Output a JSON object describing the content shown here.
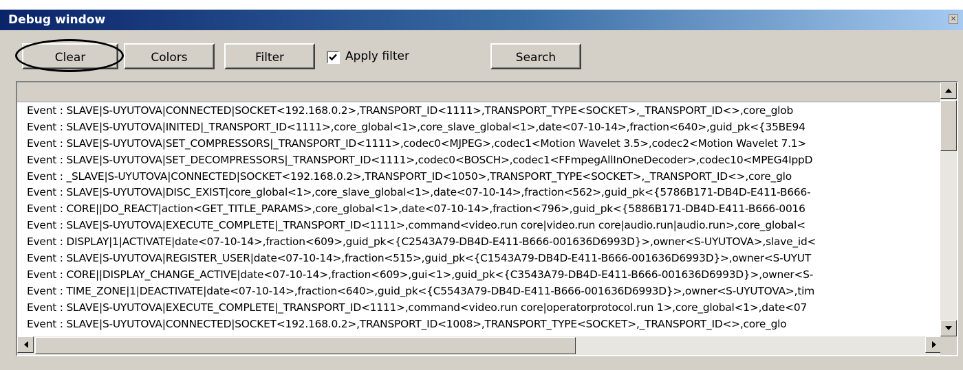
{
  "window": {
    "title": "Debug window",
    "close_glyph": "×"
  },
  "toolbar": {
    "clear_label": "Clear",
    "colors_label": "Colors",
    "filter_label": "Filter",
    "apply_filter_label": "Apply filter",
    "apply_filter_checked": true,
    "search_label": "Search"
  },
  "log": {
    "lines": [
      "Event : SLAVE|S-UYUTOVA|CONNECTED|SOCKET<192.168.0.2>,TRANSPORT_ID<1111>,TRANSPORT_TYPE<SOCKET>,_TRANSPORT_ID<>,core_glob",
      "Event : SLAVE|S-UYUTOVA|INITED|_TRANSPORT_ID<1111>,core_global<1>,core_slave_global<1>,date<07-10-14>,fraction<640>,guid_pk<{35BE94",
      "Event : SLAVE|S-UYUTOVA|SET_COMPRESSORS|_TRANSPORT_ID<1111>,codec0<MJPEG>,codec1<Motion Wavelet 3.5>,codec2<Motion Wavelet 7.1>",
      "Event : SLAVE|S-UYUTOVA|SET_DECOMPRESSORS|_TRANSPORT_ID<1111>,codec0<BOSCH>,codec1<FFmpegAllInOneDecoder>,codec10<MPEG4IppD",
      "Event : _SLAVE|S-UYUTOVA|CONNECTED|SOCKET<192.168.0.2>,TRANSPORT_ID<1050>,TRANSPORT_TYPE<SOCKET>,_TRANSPORT_ID<>,core_glo",
      "Event : SLAVE|S-UYUTOVA|DISC_EXIST|core_global<1>,core_slave_global<1>,date<07-10-14>,fraction<562>,guid_pk<{5786B171-DB4D-E411-B666-",
      "Event : CORE||DO_REACT|action<GET_TITLE_PARAMS>,core_global<1>,date<07-10-14>,fraction<796>,guid_pk<{5886B171-DB4D-E411-B666-0016",
      "Event : SLAVE|S-UYUTOVA|EXECUTE_COMPLETE|_TRANSPORT_ID<1111>,command<video.run core|video.run core|audio.run|audio.run>,core_global<",
      "Event : DISPLAY|1|ACTIVATE|date<07-10-14>,fraction<609>,guid_pk<{C2543A79-DB4D-E411-B666-001636D6993D}>,owner<S-UYUTOVA>,slave_id<",
      "Event : SLAVE|S-UYUTOVA|REGISTER_USER|date<07-10-14>,fraction<515>,guid_pk<{C1543A79-DB4D-E411-B666-001636D6993D}>,owner<S-UYUT",
      "Event : CORE||DISPLAY_CHANGE_ACTIVE|date<07-10-14>,fraction<609>,gui<1>,guid_pk<{C3543A79-DB4D-E411-B666-001636D6993D}>,owner<S-",
      "Event : TIME_ZONE|1|DEACTIVATE|date<07-10-14>,fraction<640>,guid_pk<{C5543A79-DB4D-E411-B666-001636D6993D}>,owner<S-UYUTOVA>,tim",
      "Event : SLAVE|S-UYUTOVA|EXECUTE_COMPLETE|_TRANSPORT_ID<1111>,command<video.run core|operatorprotocol.run 1>,core_global<1>,date<07",
      "Event :  SLAVE|S-UYUTOVA|CONNECTED|SOCKET<192.168.0.2>,TRANSPORT_ID<1008>,TRANSPORT_TYPE<SOCKET>,_TRANSPORT_ID<>,core_glo"
    ]
  },
  "icons": {
    "close": "close-icon",
    "check": "checkmark-icon",
    "scroll_up": "arrow-up-icon",
    "scroll_down": "arrow-down-icon",
    "scroll_left": "arrow-left-icon",
    "scroll_right": "arrow-right-icon"
  },
  "colors": {
    "titlebar_start": "#0a246a",
    "titlebar_end": "#a6caf0",
    "face": "#d4d0c8",
    "log_background": "#ffffff"
  }
}
